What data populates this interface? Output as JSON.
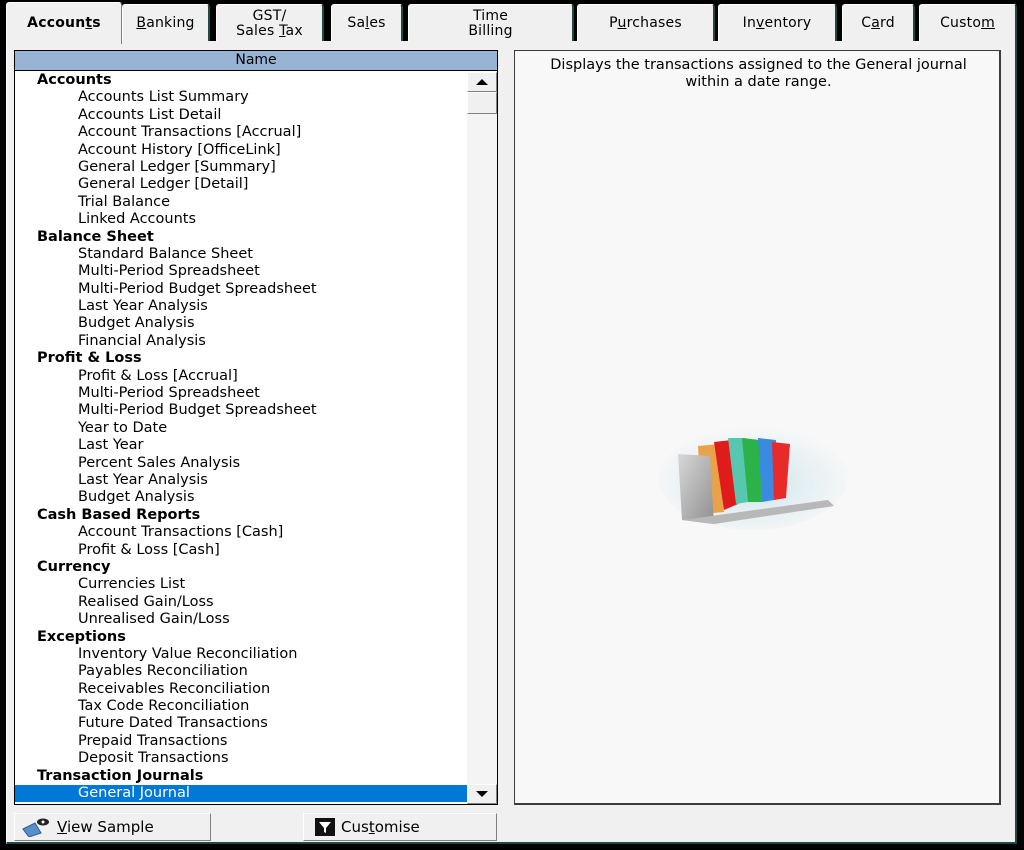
{
  "tabs": [
    {
      "label": "Accounts",
      "mnemonic_index": 6,
      "active": true
    },
    {
      "label": "Banking",
      "mnemonic_index": 0,
      "active": false
    },
    {
      "label": "GST/\nSales Tax",
      "mnemonic_index": 11,
      "active": false
    },
    {
      "label": "Sales",
      "mnemonic_index": 2,
      "active": false
    },
    {
      "label": "Time\nBilling",
      "mnemonic_index": -1,
      "active": false
    },
    {
      "label": "Purchases",
      "mnemonic_index": 1,
      "active": false
    },
    {
      "label": "Inventory",
      "mnemonic_index": 2,
      "active": false
    },
    {
      "label": "Card",
      "mnemonic_index": 1,
      "active": false
    },
    {
      "label": "Custom",
      "mnemonic_index": 5,
      "active": false
    }
  ],
  "list": {
    "header": "Name",
    "rows": [
      {
        "type": "cat",
        "text": "Accounts"
      },
      {
        "type": "item",
        "text": "Accounts List Summary"
      },
      {
        "type": "item",
        "text": "Accounts List Detail"
      },
      {
        "type": "item",
        "text": "Account Transactions [Accrual]"
      },
      {
        "type": "item",
        "text": "Account History [OfficeLink]"
      },
      {
        "type": "item",
        "text": "General Ledger [Summary]"
      },
      {
        "type": "item",
        "text": "General Ledger [Detail]"
      },
      {
        "type": "item",
        "text": "Trial Balance"
      },
      {
        "type": "item",
        "text": "Linked Accounts"
      },
      {
        "type": "cat",
        "text": "Balance Sheet"
      },
      {
        "type": "item",
        "text": "Standard Balance Sheet"
      },
      {
        "type": "item",
        "text": "Multi-Period Spreadsheet"
      },
      {
        "type": "item",
        "text": "Multi-Period Budget Spreadsheet"
      },
      {
        "type": "item",
        "text": "Last Year Analysis"
      },
      {
        "type": "item",
        "text": "Budget Analysis"
      },
      {
        "type": "item",
        "text": "Financial Analysis"
      },
      {
        "type": "cat",
        "text": "Profit & Loss"
      },
      {
        "type": "item",
        "text": "Profit & Loss [Accrual]"
      },
      {
        "type": "item",
        "text": "Multi-Period Spreadsheet"
      },
      {
        "type": "item",
        "text": "Multi-Period Budget Spreadsheet"
      },
      {
        "type": "item",
        "text": "Year to Date"
      },
      {
        "type": "item",
        "text": "Last Year"
      },
      {
        "type": "item",
        "text": "Percent Sales Analysis"
      },
      {
        "type": "item",
        "text": "Last Year Analysis"
      },
      {
        "type": "item",
        "text": "Budget Analysis"
      },
      {
        "type": "cat",
        "text": "Cash Based Reports"
      },
      {
        "type": "item",
        "text": "Account Transactions [Cash]"
      },
      {
        "type": "item",
        "text": "Profit & Loss [Cash]"
      },
      {
        "type": "cat",
        "text": "Currency"
      },
      {
        "type": "item",
        "text": "Currencies List"
      },
      {
        "type": "item",
        "text": "Realised Gain/Loss"
      },
      {
        "type": "item",
        "text": "Unrealised Gain/Loss"
      },
      {
        "type": "cat",
        "text": "Exceptions"
      },
      {
        "type": "item",
        "text": "Inventory Value Reconciliation"
      },
      {
        "type": "item",
        "text": "Payables Reconciliation"
      },
      {
        "type": "item",
        "text": "Receivables Reconciliation"
      },
      {
        "type": "item",
        "text": "Tax Code Reconciliation"
      },
      {
        "type": "item",
        "text": "Future Dated Transactions"
      },
      {
        "type": "item",
        "text": "Prepaid Transactions"
      },
      {
        "type": "item",
        "text": "Deposit Transactions"
      },
      {
        "type": "cat",
        "text": "Transaction Journals"
      },
      {
        "type": "item",
        "text": "General Journal",
        "selected": true
      }
    ]
  },
  "description": "Displays the transactions assigned to the General journal within a date range.",
  "illustration": "report-folders-icon",
  "buttons": {
    "view_sample": {
      "label": "View Sample",
      "mnemonic_index": 0,
      "icon": "view-sample-icon"
    },
    "customise": {
      "label": "Customise",
      "mnemonic_index": 3,
      "icon": "filter-icon"
    }
  },
  "colors": {
    "header_bg": "#98b4d4",
    "selection": "#0078d7",
    "panel_bg": "#f0f0f0",
    "tab_divider": "#1b4a48"
  }
}
